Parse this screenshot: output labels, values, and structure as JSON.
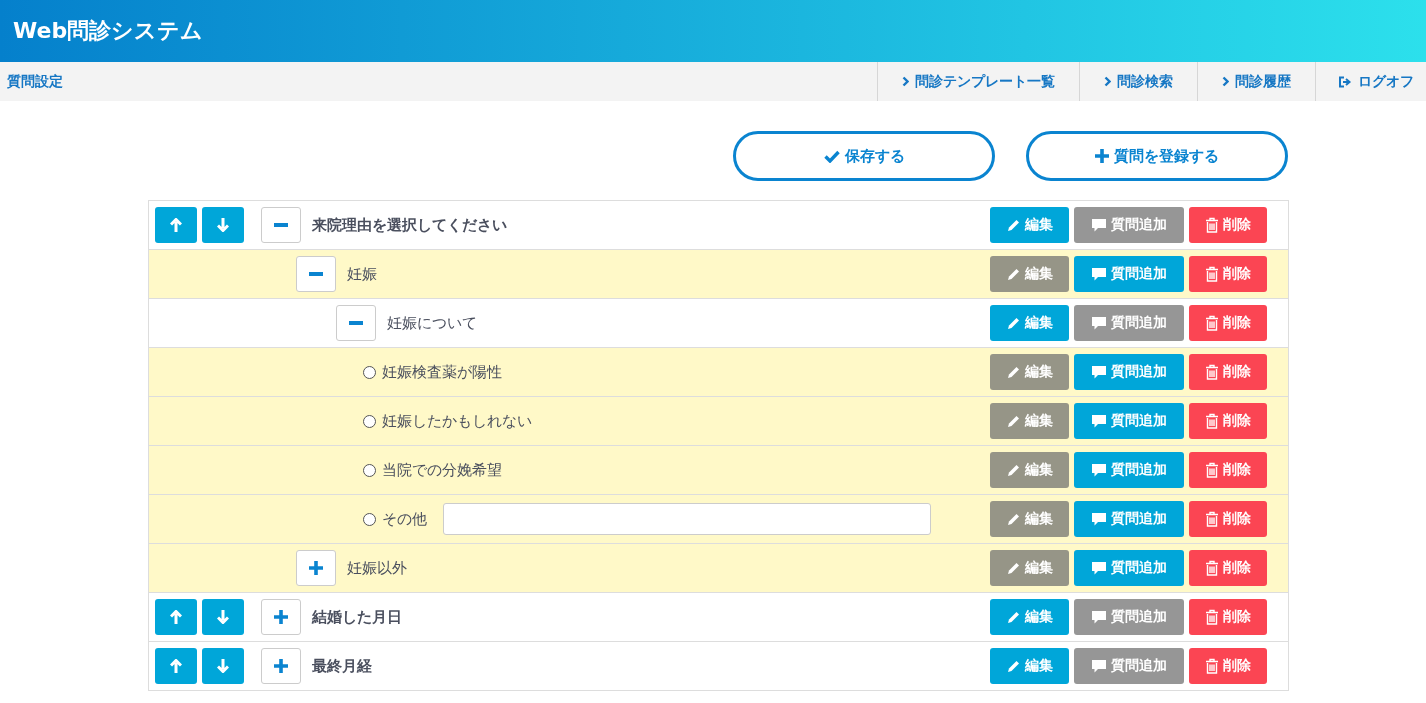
{
  "header": {
    "title": "Web問診システム"
  },
  "nav": {
    "page_title": "質問設定",
    "links": [
      {
        "kind": "link",
        "label": "問診テンプレート一覧"
      },
      {
        "kind": "link",
        "label": "問診検索"
      },
      {
        "kind": "link",
        "label": "問診履歴"
      },
      {
        "kind": "logout",
        "label": "ログオフ"
      }
    ]
  },
  "toolbar": [
    {
      "kind": "save",
      "label": "保存する"
    },
    {
      "kind": "register",
      "label": "質問を登録する"
    }
  ],
  "items": [
    {
      "kind": "question",
      "label": "来院理由を選択してください",
      "expanded": true,
      "actions": [
        {
          "kind": "edit",
          "label": "編集",
          "disabled": false
        },
        {
          "kind": "add",
          "label": "質問追加",
          "disabled": true
        },
        {
          "kind": "delete",
          "label": "削除",
          "disabled": false
        }
      ],
      "children": [
        {
          "kind": "answer",
          "label": "妊娠",
          "expanded": true,
          "actions": [
            {
              "kind": "edit",
              "label": "編集",
              "disabled": true
            },
            {
              "kind": "add",
              "label": "質問追加",
              "disabled": false
            },
            {
              "kind": "delete",
              "label": "削除",
              "disabled": false
            }
          ],
          "children": [
            {
              "kind": "question",
              "label": "妊娠について",
              "expanded": true,
              "actions": [
                {
                  "kind": "edit",
                  "label": "編集",
                  "disabled": false
                },
                {
                  "kind": "add",
                  "label": "質問追加",
                  "disabled": true
                },
                {
                  "kind": "delete",
                  "label": "削除",
                  "disabled": false
                }
              ],
              "children": [
                {
                  "kind": "option",
                  "label": "妊娠検査薬が陽性",
                  "selected": false,
                  "actions": [
                    {
                      "kind": "edit",
                      "label": "編集",
                      "disabled": true
                    },
                    {
                      "kind": "add",
                      "label": "質問追加",
                      "disabled": false
                    },
                    {
                      "kind": "delete",
                      "label": "削除",
                      "disabled": false
                    }
                  ]
                },
                {
                  "kind": "option",
                  "label": "妊娠したかもしれない",
                  "selected": false,
                  "actions": [
                    {
                      "kind": "edit",
                      "label": "編集",
                      "disabled": true
                    },
                    {
                      "kind": "add",
                      "label": "質問追加",
                      "disabled": false
                    },
                    {
                      "kind": "delete",
                      "label": "削除",
                      "disabled": false
                    }
                  ]
                },
                {
                  "kind": "option",
                  "label": "当院での分娩希望",
                  "selected": false,
                  "actions": [
                    {
                      "kind": "edit",
                      "label": "編集",
                      "disabled": true
                    },
                    {
                      "kind": "add",
                      "label": "質問追加",
                      "disabled": false
                    },
                    {
                      "kind": "delete",
                      "label": "削除",
                      "disabled": false
                    }
                  ]
                },
                {
                  "kind": "option_text",
                  "label": "その他",
                  "selected": false,
                  "actions": [
                    {
                      "kind": "edit",
                      "label": "編集",
                      "disabled": true
                    },
                    {
                      "kind": "add",
                      "label": "質問追加",
                      "disabled": false
                    },
                    {
                      "kind": "delete",
                      "label": "削除",
                      "disabled": false
                    }
                  ]
                }
              ]
            }
          ]
        },
        {
          "kind": "answer",
          "label": "妊娠以外",
          "expanded": false,
          "actions": [
            {
              "kind": "edit",
              "label": "編集",
              "disabled": true
            },
            {
              "kind": "add",
              "label": "質問追加",
              "disabled": false
            },
            {
              "kind": "delete",
              "label": "削除",
              "disabled": false
            }
          ]
        }
      ]
    },
    {
      "kind": "question",
      "label": "結婚した月日",
      "expanded": false,
      "actions": [
        {
          "kind": "edit",
          "label": "編集",
          "disabled": false
        },
        {
          "kind": "add",
          "label": "質問追加",
          "disabled": true
        },
        {
          "kind": "delete",
          "label": "削除",
          "disabled": false
        }
      ]
    },
    {
      "kind": "question",
      "label": "最終月経",
      "expanded": false,
      "actions": [
        {
          "kind": "edit",
          "label": "編集",
          "disabled": false
        },
        {
          "kind": "add",
          "label": "質問追加",
          "disabled": true
        },
        {
          "kind": "delete",
          "label": "削除",
          "disabled": false
        }
      ]
    }
  ]
}
